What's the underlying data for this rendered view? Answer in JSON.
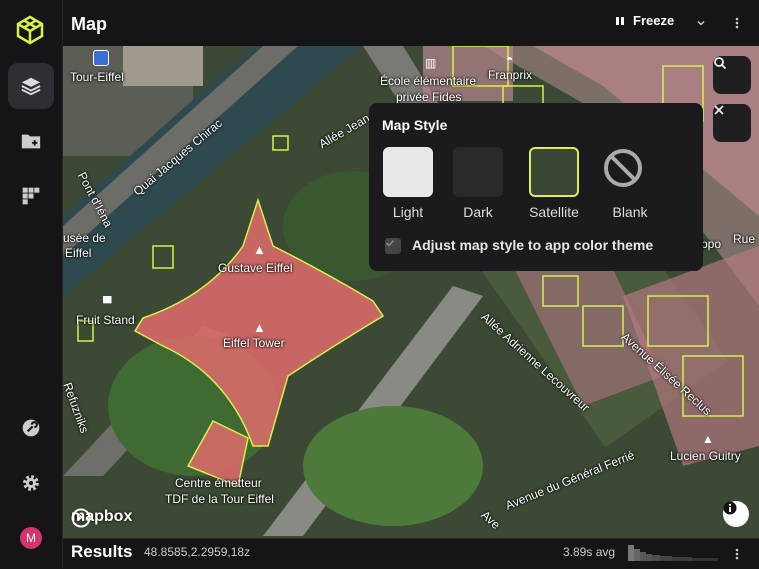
{
  "header": {
    "title": "Map",
    "freeze_label": "Freeze"
  },
  "sidebar": {
    "items": [
      "layers-icon",
      "folder-add-icon",
      "dashboard-icon",
      "wrench-icon",
      "gear-icon",
      "avatar"
    ],
    "avatar_initial": "M"
  },
  "map_style": {
    "title": "Map Style",
    "options": [
      "Light",
      "Dark",
      "Satellite",
      "Blank"
    ],
    "selected": "Satellite",
    "adjust_label": "Adjust map style to app color theme",
    "adjust_checked": true
  },
  "map": {
    "labels": {
      "tour_eiffel": "Tour-Eiffel",
      "ecole_line1": "École élémentaire",
      "ecole_line2": "privée Fides",
      "franprix": "Franprix",
      "quai": "Quai Jacques Chirac",
      "allee_jean": "Allée Jean",
      "pont": "Pont d'Iéna",
      "musee_line1": "usée de",
      "musee_line2": "Eiffel",
      "gustave": "Gustave Eiffel",
      "fruit": "Fruit Stand",
      "eiffel_tower": "Eiffel Tower",
      "refuzniks": "Refuzniks",
      "adrienne": "Allée Adrienne Lecouvreur",
      "elisee": "Avenue Élisée Reclus",
      "lucien": "Lucien Guitry",
      "general": "Avenue du Général Ferrié",
      "centre_line1": "Centre émetteur",
      "centre_line2": "TDF de la Tour Eiffel",
      "rue": "Rue",
      "ppo": "ppo",
      "ave": "Ave"
    },
    "attribution": "mapbox"
  },
  "results": {
    "title": "Results",
    "coords": "48.8585,2.2959,18z",
    "avg": "3.89s avg"
  },
  "colors": {
    "accent": "#d7f04b",
    "building_fill": "#e06b6b",
    "panel_bg": "#1b1b1e"
  }
}
